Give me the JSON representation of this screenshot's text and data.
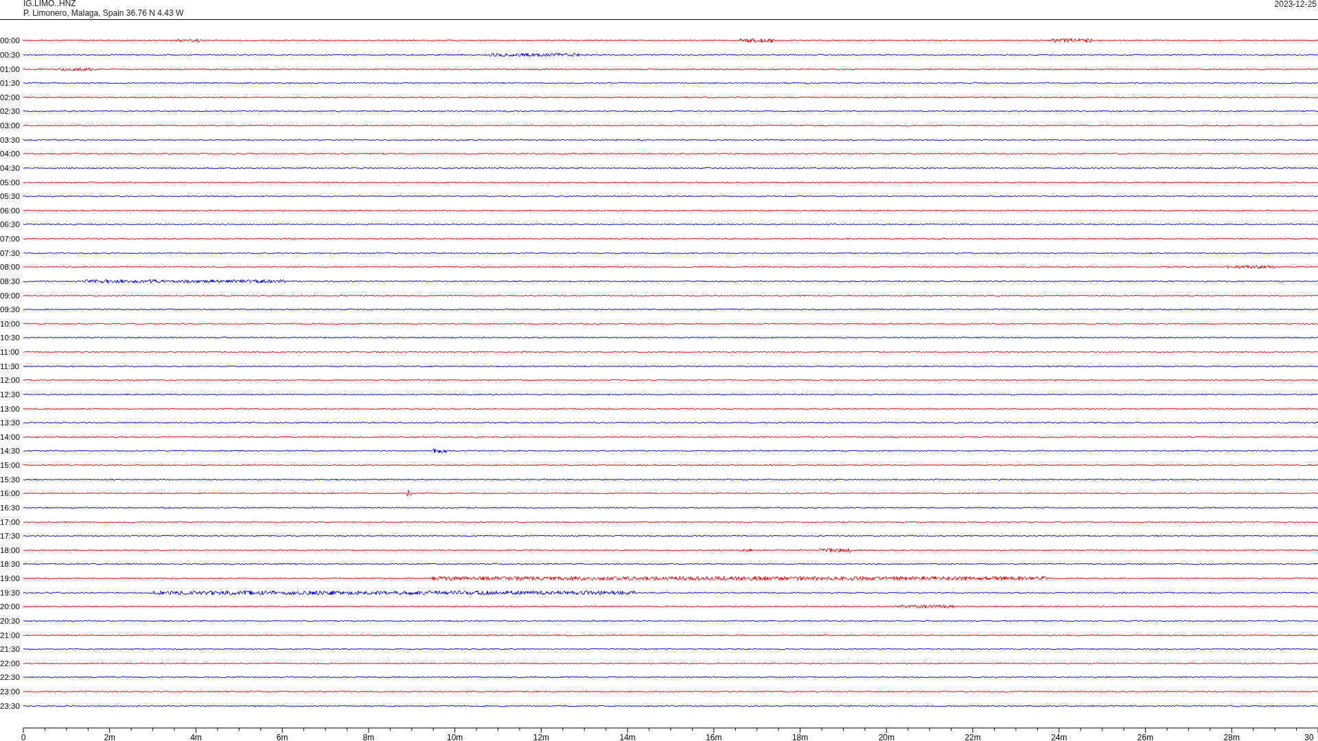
{
  "header": {
    "station": "IG.LIMO..HNZ",
    "location": "P. Limonero, Malaga, Spain  36.76 N 4.43 W",
    "date": "2023-12-25"
  },
  "traces": [
    {
      "time": "00:00",
      "color": "#ff0000"
    },
    {
      "time": "00:30",
      "color": "#0000ff"
    },
    {
      "time": "01:00",
      "color": "#ff0000"
    },
    {
      "time": "01:30",
      "color": "#0000ff"
    },
    {
      "time": "02:00",
      "color": "#ff0000"
    },
    {
      "time": "02:30",
      "color": "#0000ff"
    },
    {
      "time": "03:00",
      "color": "#ff0000"
    },
    {
      "time": "03:30",
      "color": "#0000ff"
    },
    {
      "time": "04:00",
      "color": "#ff0000"
    },
    {
      "time": "04:30",
      "color": "#0000ff"
    },
    {
      "time": "05:00",
      "color": "#ff0000"
    },
    {
      "time": "05:30",
      "color": "#0000ff"
    },
    {
      "time": "06:00",
      "color": "#ff0000"
    },
    {
      "time": "06:30",
      "color": "#0000ff"
    },
    {
      "time": "07:00",
      "color": "#ff0000"
    },
    {
      "time": "07:30",
      "color": "#0000ff"
    },
    {
      "time": "08:00",
      "color": "#ff0000"
    },
    {
      "time": "08:30",
      "color": "#0000ff"
    },
    {
      "time": "09:00",
      "color": "#ff0000"
    },
    {
      "time": "09:30",
      "color": "#0000ff"
    },
    {
      "time": "10:00",
      "color": "#ff0000"
    },
    {
      "time": "10:30",
      "color": "#0000ff"
    },
    {
      "time": "11:00",
      "color": "#ff0000"
    },
    {
      "time": "11:30",
      "color": "#0000ff"
    },
    {
      "time": "12:00",
      "color": "#ff0000"
    },
    {
      "time": "12:30",
      "color": "#0000ff"
    },
    {
      "time": "13:00",
      "color": "#ff0000"
    },
    {
      "time": "13:30",
      "color": "#0000ff"
    },
    {
      "time": "14:00",
      "color": "#ff0000"
    },
    {
      "time": "14:30",
      "color": "#0000ff"
    },
    {
      "time": "15:00",
      "color": "#ff0000"
    },
    {
      "time": "15:30",
      "color": "#0000ff"
    },
    {
      "time": "16:00",
      "color": "#ff0000"
    },
    {
      "time": "16:30",
      "color": "#0000ff"
    },
    {
      "time": "17:00",
      "color": "#ff0000"
    },
    {
      "time": "17:30",
      "color": "#0000ff"
    },
    {
      "time": "18:00",
      "color": "#ff0000"
    },
    {
      "time": "18:30",
      "color": "#0000ff"
    },
    {
      "time": "19:00",
      "color": "#ff0000"
    },
    {
      "time": "19:30",
      "color": "#0000ff"
    },
    {
      "time": "20:00",
      "color": "#ff0000"
    },
    {
      "time": "20:30",
      "color": "#0000ff"
    },
    {
      "time": "21:00",
      "color": "#ff0000"
    },
    {
      "time": "21:30",
      "color": "#0000ff"
    },
    {
      "time": "22:00",
      "color": "#ff0000"
    },
    {
      "time": "22:30",
      "color": "#0000ff"
    },
    {
      "time": "23:00",
      "color": "#ff0000"
    },
    {
      "time": "23:30",
      "color": "#0000ff"
    }
  ],
  "time_axis": {
    "labels": [
      "0",
      "2m",
      "4m",
      "6m",
      "8m",
      "10m",
      "12m",
      "14m",
      "16m",
      "18m",
      "20m",
      "22m",
      "24m",
      "26m",
      "28m",
      "30"
    ]
  }
}
